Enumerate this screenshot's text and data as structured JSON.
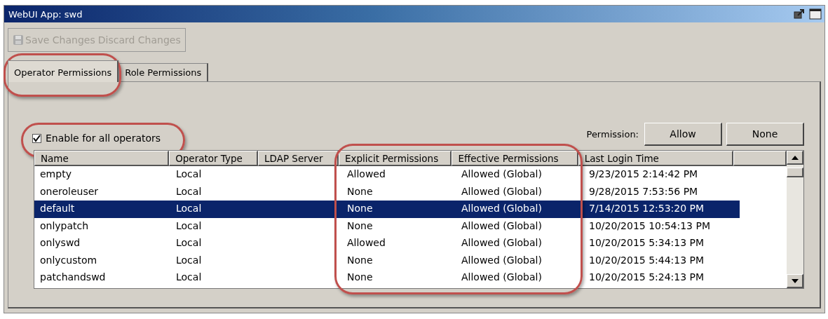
{
  "window": {
    "title": "WebUI App: swd"
  },
  "toolbar": {
    "buttons": [
      {
        "label": "Save Changes",
        "disabled": true
      },
      {
        "label": "Discard Changes",
        "disabled": true
      }
    ]
  },
  "tabs": [
    {
      "label": "Operator Permissions",
      "selected": true
    },
    {
      "label": "Role Permissions",
      "selected": false
    }
  ],
  "enable_all": {
    "label": "Enable for all operators",
    "checked": true
  },
  "permission": {
    "label": "Permission:",
    "buttons": [
      "Allow",
      "None"
    ]
  },
  "table": {
    "columns": [
      "Name",
      "Operator Type",
      "LDAP Server",
      "Explicit Permissions",
      "Effective Permissions",
      "Last Login Time",
      ""
    ],
    "rows": [
      {
        "cells": [
          "empty",
          "Local",
          "",
          "Allowed",
          "Allowed (Global)",
          "9/23/2015 2:14:42 PM"
        ],
        "selected": false
      },
      {
        "cells": [
          "oneroleuser",
          "Local",
          "",
          "None",
          "Allowed (Global)",
          "9/28/2015 7:53:56 PM"
        ],
        "selected": false
      },
      {
        "cells": [
          "default",
          "Local",
          "",
          "None",
          "Allowed (Global)",
          "7/14/2015 12:53:20 PM"
        ],
        "selected": true
      },
      {
        "cells": [
          "onlypatch",
          "Local",
          "",
          "None",
          "Allowed (Global)",
          "10/20/2015 10:54:13 PM"
        ],
        "selected": false
      },
      {
        "cells": [
          "onlyswd",
          "Local",
          "",
          "Allowed",
          "Allowed (Global)",
          "10/20/2015 5:34:13 PM"
        ],
        "selected": false
      },
      {
        "cells": [
          "onlycustom",
          "Local",
          "",
          "None",
          "Allowed (Global)",
          "10/20/2015 5:44:13 PM"
        ],
        "selected": false
      },
      {
        "cells": [
          "patchandswd",
          "Local",
          "",
          "None",
          "Allowed (Global)",
          "10/20/2015 5:24:13 PM"
        ],
        "selected": false
      }
    ]
  }
}
